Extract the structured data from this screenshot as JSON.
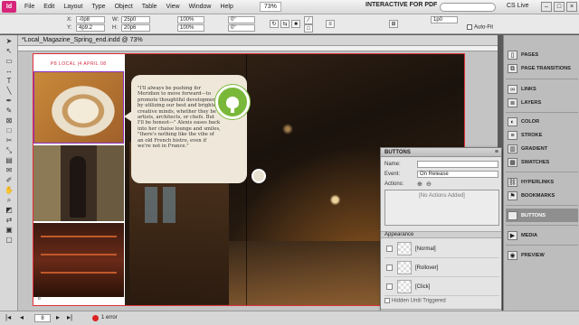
{
  "app": {
    "logo": "Id",
    "menu": [
      "File",
      "Edit",
      "Layout",
      "Type",
      "Object",
      "Table",
      "View",
      "Window",
      "Help"
    ],
    "zoom": "73%",
    "workspace": "INTERACTIVE FOR PDF",
    "cs_live": "CS Live"
  },
  "control": {
    "x_label": "X:",
    "x_value": "-0p8",
    "y_label": "Y:",
    "y_value": "4p9.2",
    "w_label": "W:",
    "w_value": "25p0",
    "h_label": "H:",
    "h_value": "20p6",
    "scale_x": "100%",
    "scale_y": "100%",
    "rotate": "0°",
    "shear": "0°",
    "stroke_weight": "1p0",
    "autofit_label": "Auto-Fit"
  },
  "document": {
    "tab_title": "*Local_Magazine_Spring_end.indd @ 73%",
    "header_text": "P8   LOCAL  |4  APRIL  08",
    "page_number": "8",
    "quote_text": "\"I'll always be pushing for Meridien to move forward—to promote thoughtful development by utilizing our best and brightest creative minds, whether they be artists, architects, or chefs. But I'll be honest—\" Alexis eases back into her chaise lounge and smiles, \"there's nothing like the vibe of an old French bistro, even if we're not in France.\""
  },
  "buttons_panel": {
    "title": "BUTTONS",
    "name_label": "Name:",
    "name_value": "",
    "event_label": "Event:",
    "event_value": "On Release",
    "actions_label": "Actions:",
    "no_actions": "[No Actions Added]",
    "appearance_label": "Appearance",
    "states": [
      "[Normal]",
      "[Rollover]",
      "[Click]"
    ],
    "hidden_label": "Hidden Until Triggered"
  },
  "dock": [
    {
      "label": "PAGES",
      "icon": "pages-icon"
    },
    {
      "label": "PAGE TRANSITIONS",
      "icon": "page-transitions-icon"
    },
    {
      "label": "LINKS",
      "icon": "links-icon"
    },
    {
      "label": "LAYERS",
      "icon": "layers-icon"
    },
    {
      "label": "COLOR",
      "icon": "color-icon"
    },
    {
      "label": "STROKE",
      "icon": "stroke-icon"
    },
    {
      "label": "GRADIENT",
      "icon": "gradient-icon"
    },
    {
      "label": "SWATCHES",
      "icon": "swatches-icon"
    },
    {
      "label": "HYPERLINKS",
      "icon": "hyperlinks-icon"
    },
    {
      "label": "BOOKMARKS",
      "icon": "bookmarks-icon"
    },
    {
      "label": "BUTTONS",
      "icon": "buttons-icon"
    },
    {
      "label": "MEDIA",
      "icon": "media-icon"
    },
    {
      "label": "PREVIEW",
      "icon": "preview-icon"
    }
  ],
  "status": {
    "page_field": "8",
    "errors": "1 error"
  },
  "colors": {
    "accent_green": "#7ab83a",
    "bleed_red": "#e0303a",
    "error_red": "#dd2222"
  }
}
